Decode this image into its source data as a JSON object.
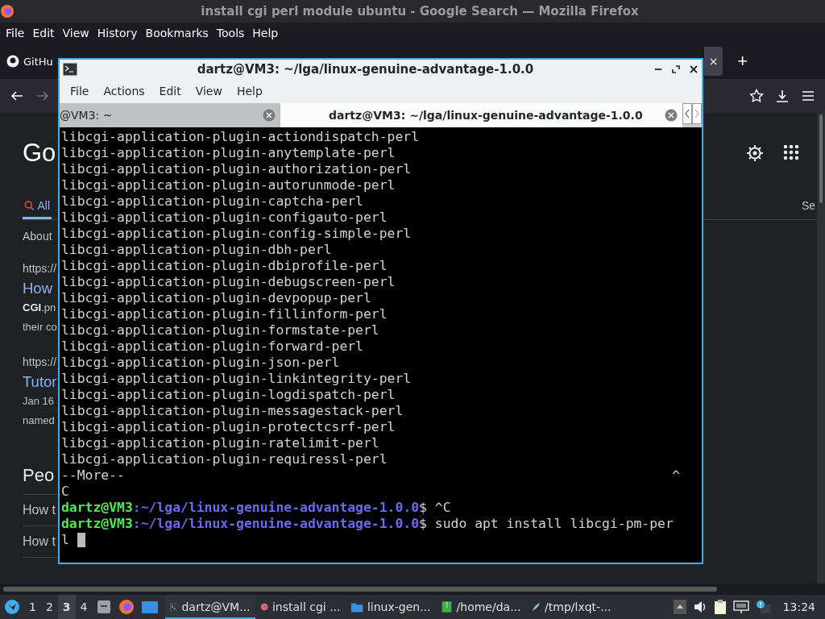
{
  "firefox": {
    "title": "install cgi perl module ubuntu - Google Search — Mozilla Firefox",
    "menu": [
      "File",
      "Edit",
      "View",
      "History",
      "Bookmarks",
      "Tools",
      "Help"
    ],
    "tabs": [
      {
        "label": "GitHu",
        "selected": false
      },
      {
        "label": "×",
        "selected": true
      }
    ],
    "new_tab": "+",
    "content": {
      "logo": "Go",
      "search_tabs": [
        {
          "label": "All",
          "selected": true
        },
        {
          "label": "Se",
          "selected": false
        }
      ],
      "about": "About",
      "results": [
        {
          "url": "https://",
          "title": "How",
          "snippet": [
            "**CGI**.pn",
            "their co"
          ]
        },
        {
          "url": "https://",
          "title": "Tutor",
          "snippet": [
            "Jan 16",
            "named"
          ]
        }
      ],
      "people_heading": "Peo",
      "questions": [
        "How t",
        "How t"
      ]
    }
  },
  "terminal": {
    "title": "dartz@VM3: ~/lga/linux-genuine-advantage-1.0.0",
    "menu": [
      "File",
      "Actions",
      "Edit",
      "View",
      "Help"
    ],
    "tabs": [
      {
        "label": "@VM3: ~",
        "selected": false
      },
      {
        "label": "dartz@VM3: ~/lga/linux-genuine-advantage-1.0.0",
        "selected": true
      }
    ],
    "lines": [
      {
        "kind": "plain",
        "text": "libcgi-application-plugin-actiondispatch-perl"
      },
      {
        "kind": "plain",
        "text": "libcgi-application-plugin-anytemplate-perl"
      },
      {
        "kind": "plain",
        "text": "libcgi-application-plugin-authorization-perl"
      },
      {
        "kind": "plain",
        "text": "libcgi-application-plugin-autorunmode-perl"
      },
      {
        "kind": "plain",
        "text": "libcgi-application-plugin-captcha-perl"
      },
      {
        "kind": "plain",
        "text": "libcgi-application-plugin-configauto-perl"
      },
      {
        "kind": "plain",
        "text": "libcgi-application-plugin-config-simple-perl"
      },
      {
        "kind": "plain",
        "text": "libcgi-application-plugin-dbh-perl"
      },
      {
        "kind": "plain",
        "text": "libcgi-application-plugin-dbiprofile-perl"
      },
      {
        "kind": "plain",
        "text": "libcgi-application-plugin-debugscreen-perl"
      },
      {
        "kind": "plain",
        "text": "libcgi-application-plugin-devpopup-perl"
      },
      {
        "kind": "plain",
        "text": "libcgi-application-plugin-fillinform-perl"
      },
      {
        "kind": "plain",
        "text": "libcgi-application-plugin-formstate-perl"
      },
      {
        "kind": "plain",
        "text": "libcgi-application-plugin-forward-perl"
      },
      {
        "kind": "plain",
        "text": "libcgi-application-plugin-json-perl"
      },
      {
        "kind": "plain",
        "text": "libcgi-application-plugin-linkintegrity-perl"
      },
      {
        "kind": "plain",
        "text": "libcgi-application-plugin-logdispatch-perl"
      },
      {
        "kind": "plain",
        "text": "libcgi-application-plugin-messagestack-perl"
      },
      {
        "kind": "plain",
        "text": "libcgi-application-plugin-protectcsrf-perl"
      },
      {
        "kind": "plain",
        "text": "libcgi-application-plugin-ratelimit-perl"
      },
      {
        "kind": "plain",
        "text": "libcgi-application-plugin-requiressl-perl"
      },
      {
        "kind": "more",
        "text": "--More--",
        "marker": "^"
      },
      {
        "kind": "plain",
        "text": "C"
      },
      {
        "kind": "prompt",
        "user": "dartz@VM3",
        "path": ":~/lga/linux-genuine-advantage-1.0.0",
        "command": "$ ^C"
      },
      {
        "kind": "prompt",
        "user": "dartz@VM3",
        "path": ":~/lga/linux-genuine-advantage-1.0.0",
        "command": "$ sudo apt install libcgi-pm-per"
      },
      {
        "kind": "plain",
        "text": "l",
        "cursor": true
      }
    ]
  },
  "taskbar": {
    "workspaces": [
      {
        "label": "1",
        "selected": false
      },
      {
        "label": "2",
        "selected": false
      },
      {
        "label": "3",
        "selected": true
      },
      {
        "label": "4",
        "selected": false
      }
    ],
    "tasks": [
      {
        "kind": "terminal",
        "label": "dartz@VM...",
        "selected": true
      },
      {
        "kind": "browser",
        "label": "install cgi ...",
        "selected": false
      },
      {
        "kind": "folder",
        "label": "linux-gen...",
        "selected": false
      },
      {
        "kind": "archive",
        "label": "/home/da...",
        "selected": false
      },
      {
        "kind": "editor",
        "label": "/tmp/lxqt-...",
        "selected": false
      }
    ],
    "clock": "13:24"
  }
}
